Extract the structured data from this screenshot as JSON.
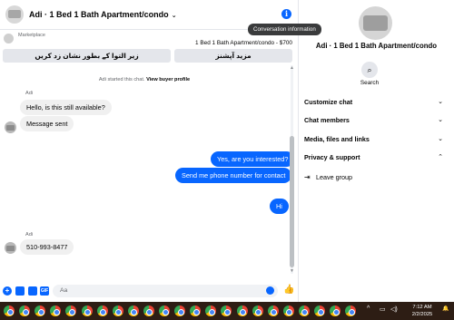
{
  "chat": {
    "title": "Adi · 1 Bed 1 Bath Apartment/condo",
    "tooltip": "Conversation information",
    "marketplace_label": "Marketplace",
    "listing": "1 Bed 1 Bath Apartment/condo - $700",
    "buttons": [
      "زیر التوا کے بطور نشان زد کریں",
      "مزید آپشنز"
    ],
    "system_message": {
      "text": "Adi started this chat. ",
      "link": "View buyer profile"
    },
    "messages": [
      {
        "sender": "Adi",
        "text": "Hello, is this still available?",
        "direction": "in"
      },
      {
        "sender": "",
        "text": "Message sent",
        "direction": "in"
      },
      {
        "sender": "",
        "text": "Yes, are you interested?",
        "direction": "out"
      },
      {
        "sender": "",
        "text": "Send me phone number for contact",
        "direction": "out"
      },
      {
        "sender": "",
        "text": "Hi",
        "direction": "out"
      },
      {
        "sender": "Adi",
        "text": "510-993-8477",
        "direction": "in"
      }
    ],
    "composer_placeholder": "Aa"
  },
  "info_panel": {
    "name": "Adi · 1 Bed 1 Bath Apartment/condo",
    "search_label": "Search",
    "sections": [
      "Customize chat",
      "Chat members",
      "Media, files and links",
      "Privacy & support"
    ],
    "leave_group": "Leave group"
  },
  "taskbar": {
    "app_count": 23,
    "time": "7:12 AM",
    "date": "2/2/2025"
  },
  "colors": {
    "accent": "#0866ff",
    "taskbar": "#2d1d14"
  }
}
